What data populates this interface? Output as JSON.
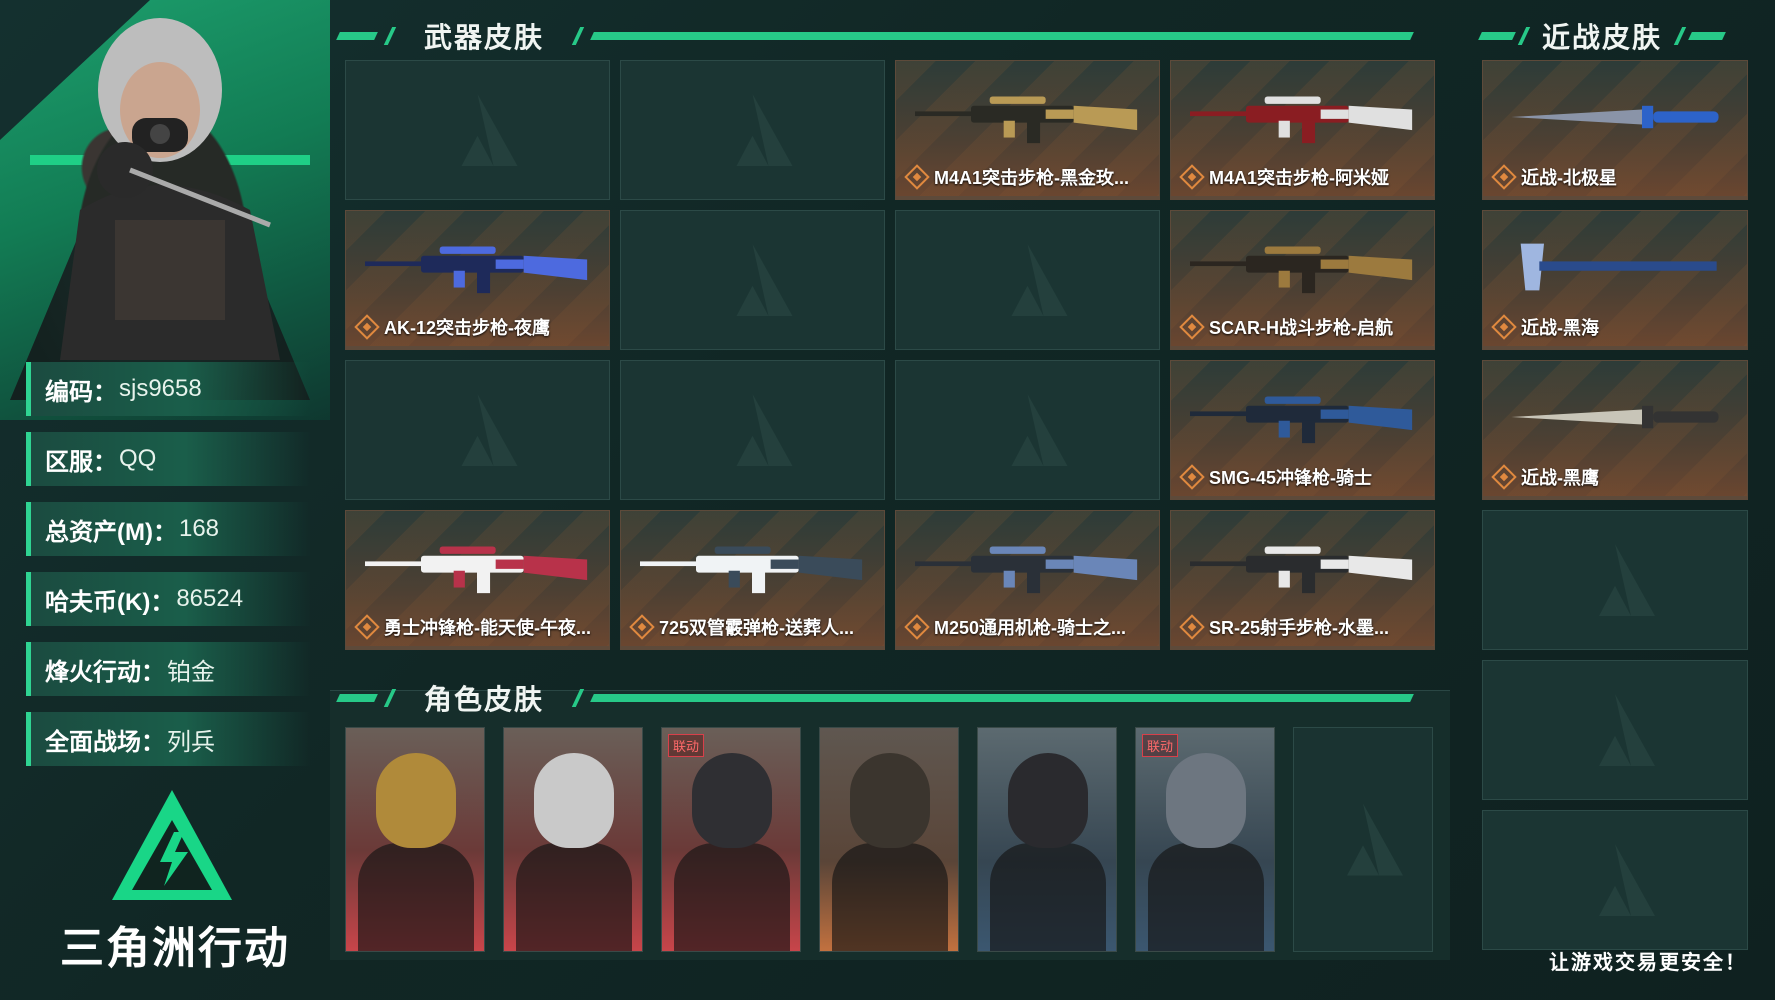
{
  "profile": {
    "rows": [
      {
        "key": "编码：",
        "value": "sjs9658"
      },
      {
        "key": "区服：",
        "value": "QQ"
      },
      {
        "key": "总资产(M)：",
        "value": "168"
      },
      {
        "key": "哈夫币(K)：",
        "value": "86524"
      },
      {
        "key": "烽火行动：",
        "value": "铂金"
      },
      {
        "key": "全面战场：",
        "value": "列兵"
      }
    ]
  },
  "logo": {
    "text": "三角洲行动"
  },
  "sections": {
    "weapon_title": "武器皮肤",
    "melee_title": "近战皮肤",
    "character_title": "角色皮肤"
  },
  "weapons": [
    {
      "label": ""
    },
    {
      "label": ""
    },
    {
      "label": "M4A1突击步枪-黑金玫...",
      "icon": "rifle-gold"
    },
    {
      "label": "M4A1突击步枪-阿米娅",
      "icon": "rifle-red"
    },
    {
      "label": "AK-12突击步枪-夜鹰",
      "icon": "rifle-blue"
    },
    {
      "label": ""
    },
    {
      "label": ""
    },
    {
      "label": "SCAR-H战斗步枪-启航",
      "icon": "rifle-bronze"
    },
    {
      "label": ""
    },
    {
      "label": ""
    },
    {
      "label": ""
    },
    {
      "label": "SMG-45冲锋枪-骑士",
      "icon": "smg-navy"
    },
    {
      "label": "勇士冲锋枪-能天使-午夜...",
      "icon": "smg-pink"
    },
    {
      "label": "725双管霰弹枪-送葬人...",
      "icon": "shotgun-white"
    },
    {
      "label": "M250通用机枪-骑士之...",
      "icon": "mg-blue"
    },
    {
      "label": "SR-25射手步枪-水墨...",
      "icon": "rifle-white"
    }
  ],
  "melee": [
    {
      "label": "近战-北极星",
      "icon": "knife-blue"
    },
    {
      "label": "近战-黑海",
      "icon": "axe-blue"
    },
    {
      "label": "近战-黑鹰",
      "icon": "knife-silver"
    },
    {
      "label": ""
    },
    {
      "label": ""
    },
    {
      "label": ""
    }
  ],
  "characters": [
    {
      "style": "red",
      "badge": "",
      "icon": "operator-gold-mask"
    },
    {
      "style": "red",
      "badge": "",
      "icon": "operator-white-hair"
    },
    {
      "style": "red",
      "badge": "联动",
      "icon": "operator-cap-mask"
    },
    {
      "style": "brown",
      "badge": "",
      "icon": "operator-helmet"
    },
    {
      "style": "blue",
      "badge": "",
      "icon": "operator-male"
    },
    {
      "style": "blue",
      "badge": "联动",
      "icon": "operator-collab"
    },
    {
      "style": "empty",
      "badge": "",
      "icon": ""
    }
  ],
  "footer": {
    "slogan": "让游戏交易更安全！"
  },
  "colors": {
    "accent": "#27c988",
    "orange": "#d0743b",
    "bg": "#12282a"
  }
}
